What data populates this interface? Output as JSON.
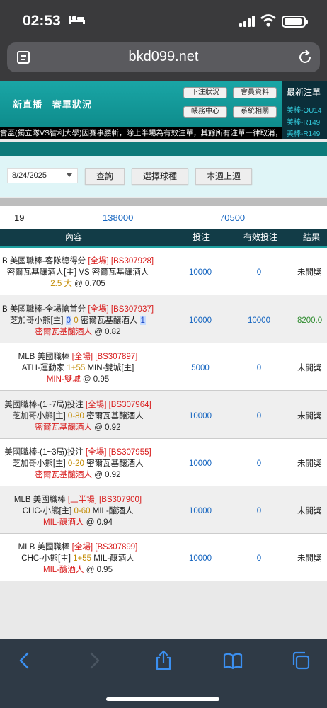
{
  "status": {
    "time": "02:53"
  },
  "browser": {
    "url": "bkd099.net"
  },
  "header": {
    "nav_live": "新直播",
    "nav_review": "審單狀況",
    "btn_bet_status": "下注狀況",
    "btn_member": "會員資料",
    "btn_account": "帳務中心",
    "btn_system": "系統相關",
    "latest_title": "最新注單",
    "latest_items": [
      "美棒-OU14",
      "美棒-R149",
      "美棒-R149"
    ]
  },
  "marquee": "會盃(獨立隊VS智利大學)因賽事腰斬，除上半場為有效注單，其餘所有注單一律取消，過關",
  "filters": {
    "date": "8/24/2025",
    "query_btn": "查詢",
    "sport_btn": "選擇球種",
    "week_btn": "本週上週"
  },
  "summary": {
    "count": "19",
    "stake": "138000",
    "valid": "70500"
  },
  "table": {
    "headers": {
      "content": "內容",
      "stake": "投注",
      "valid": "有效投注",
      "result": "結果"
    },
    "rows": [
      {
        "l1_a": "B 美國職棒-客隊總得分 ",
        "l1_tag": "[全場] [BS307928]",
        "l2": "密爾瓦基釀酒人[主] VS 密爾瓦基釀酒人",
        "l3_a": "2.5 大",
        "l3_b": " @ 0.705",
        "stake": "10000",
        "valid": "0",
        "result": "未開獎"
      },
      {
        "l1_a": "B 美國職棒-全場搶首分 ",
        "l1_tag": "[全場] [BS307937]",
        "l2_a": "芝加哥小熊[主] ",
        "l2_h1": "0",
        "l2_h2": "0",
        "l2_b": " 密爾瓦基釀酒人 ",
        "l2_h3": "1",
        "l3_a": "密爾瓦基釀酒人",
        "l3_b": " @ 0.82",
        "stake": "10000",
        "valid": "10000",
        "result": "8200.0"
      },
      {
        "l1_a": "MLB 美國職棒 ",
        "l1_tag": "[全場] [BS307897]",
        "l2_a": "ATH-運動家 ",
        "l2_g": "1+55",
        "l2_b": " MIN-雙城[主]",
        "l3_a": "MIN-雙城",
        "l3_b": " @ 0.95",
        "stake": "5000",
        "valid": "0",
        "result": "未開獎"
      },
      {
        "l1_a": " 美國職棒-(1~7局)投注 ",
        "l1_tag": "[全場] [BS307964]",
        "l2_a": "芝加哥小熊[主] ",
        "l2_g": "0-80",
        "l2_b": " 密爾瓦基釀酒人",
        "l3_a": "密爾瓦基釀酒人",
        "l3_b": " @ 0.92",
        "stake": "10000",
        "valid": "0",
        "result": "未開獎"
      },
      {
        "l1_a": "美國職棒-(1~3局)投注 ",
        "l1_tag": "[全場] [BS307955]",
        "l2_a": "芝加哥小熊[主] ",
        "l2_g": "0-20",
        "l2_b": " 密爾瓦基釀酒人",
        "l3_a": "密爾瓦基釀酒人",
        "l3_b": " @ 0.92",
        "stake": "10000",
        "valid": "0",
        "result": "未開獎"
      },
      {
        "l1_a": "MLB 美國職棒 ",
        "l1_tag": "[上半場] [BS307900]",
        "l2_a": "CHC-小熊[主] ",
        "l2_g": "0-60",
        "l2_b": " MIL-釀酒人",
        "l3_a": "MIL-釀酒人",
        "l3_b": " @ 0.94",
        "stake": "10000",
        "valid": "0",
        "result": "未開獎"
      },
      {
        "l1_a": "MLB 美國職棒 ",
        "l1_tag": "[全場] [BS307899]",
        "l2_a": "CHC-小熊[主] ",
        "l2_g": "1+55",
        "l2_b": " MIL-釀酒人",
        "l3_a": "MIL-釀酒人",
        "l3_b": " @ 0.95",
        "stake": "10000",
        "valid": "0",
        "result": "未開獎"
      }
    ]
  },
  "toolbar_icons": [
    "back-icon",
    "forward-icon",
    "share-icon",
    "bookmarks-icon",
    "tabs-icon"
  ]
}
